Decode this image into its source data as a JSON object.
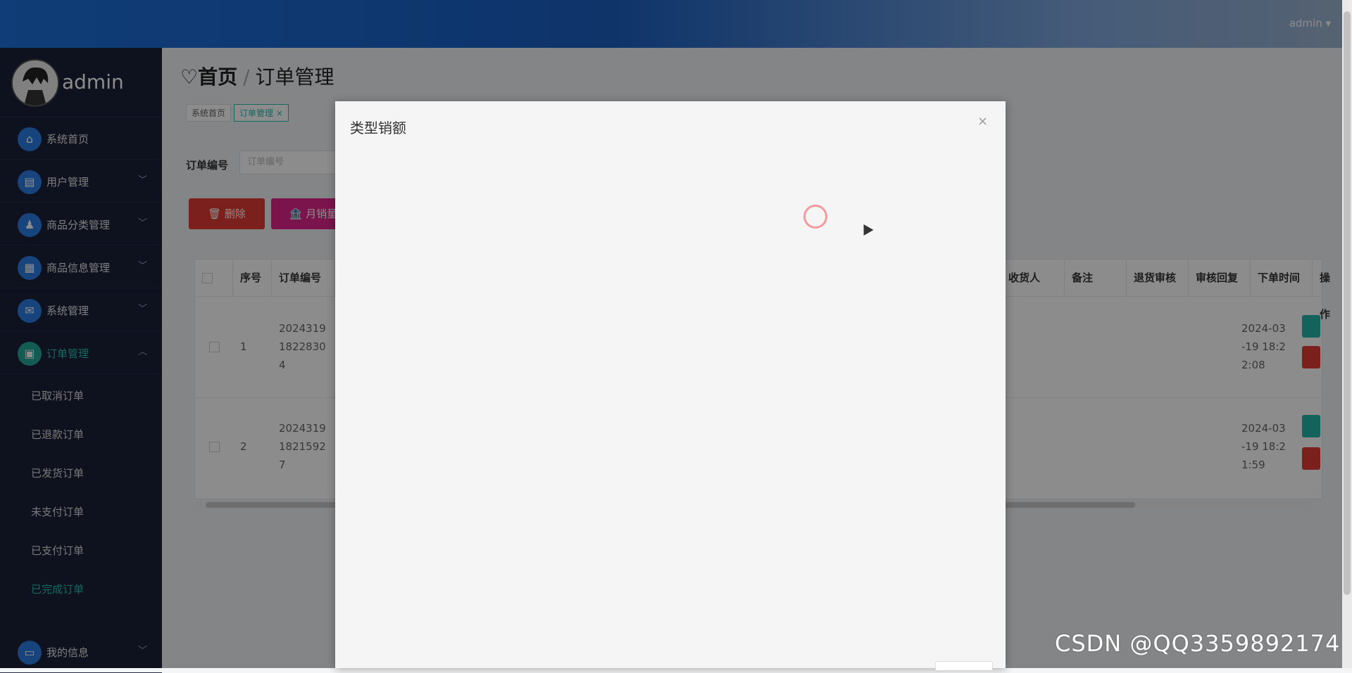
{
  "topbar": {
    "user": "admin ▾"
  },
  "sidebar": {
    "profile_name": "admin",
    "items": [
      {
        "label": "系统首页",
        "icon": "home-icon",
        "glyph": "⌂",
        "chevron": ""
      },
      {
        "label": "用户管理",
        "icon": "chart-icon",
        "glyph": "▤",
        "chevron": "﹀"
      },
      {
        "label": "商品分类管理",
        "icon": "person-icon",
        "glyph": "♟",
        "chevron": "﹀"
      },
      {
        "label": "商品信息管理",
        "icon": "grid-icon",
        "glyph": "▦",
        "chevron": "﹀"
      },
      {
        "label": "系统管理",
        "icon": "chat-icon",
        "glyph": "✉",
        "chevron": "﹀"
      },
      {
        "label": "订单管理",
        "icon": "clipboard-icon",
        "glyph": "▣",
        "chevron": "︿"
      }
    ],
    "sub_items": [
      "已取消订单",
      "已退款订单",
      "已发货订单",
      "未支付订单",
      "已支付订单",
      "已完成订单"
    ],
    "bottom_item": {
      "label": "我的信息",
      "icon": "card-icon",
      "glyph": "▭",
      "chevron": "﹀"
    }
  },
  "breadcrumb": {
    "home": "♡首页",
    "sep": "/",
    "current": "订单管理"
  },
  "tabs": [
    "系统首页",
    "订单管理 ×"
  ],
  "search": {
    "label": "订单编号",
    "placeholder": "订单编号"
  },
  "toolbar": {
    "delete": "🗑 删除",
    "monthly": "🏦 月销量"
  },
  "table": {
    "headers_left": [
      "序号",
      "订单编号"
    ],
    "headers_right": [
      "收货人",
      "备注",
      "退货审核",
      "审核回复",
      "下单时间",
      "操作"
    ],
    "rows": [
      {
        "index": "1",
        "order_no": "2024319\n1822830\n4",
        "time": "2024-03\n-19 18:2\n2:08"
      },
      {
        "index": "2",
        "order_no": "2024319\n1821592\n7",
        "time": "2024-03\n-19 18:2\n1:59"
      }
    ]
  },
  "modal": {
    "title": "类型销额",
    "close": "×"
  },
  "watermark": "CSDN @QQ3359892174"
}
